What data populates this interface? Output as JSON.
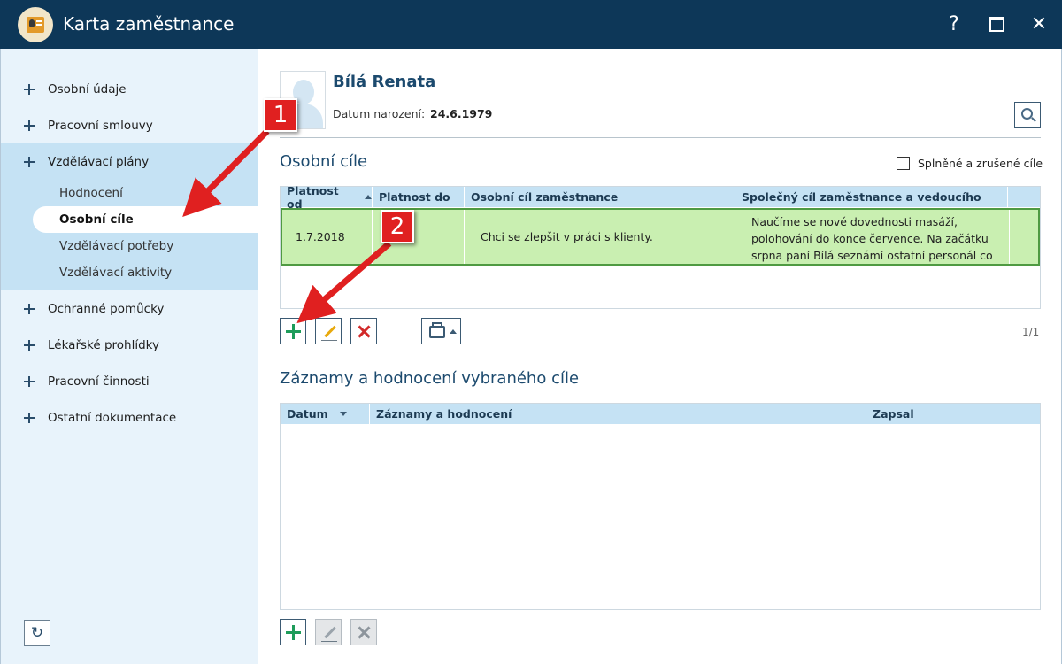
{
  "window": {
    "title": "Karta zaměstnance",
    "help_glyph": "?",
    "close_glyph": "✕"
  },
  "sidebar": {
    "items": [
      {
        "label": "Osobní údaje"
      },
      {
        "label": "Pracovní smlouvy"
      },
      {
        "label": "Vzdělávací plány"
      },
      {
        "label": "Ochranné pomůcky"
      },
      {
        "label": "Lékařské prohlídky"
      },
      {
        "label": "Pracovní činnosti"
      },
      {
        "label": "Ostatní dokumentace"
      }
    ],
    "sub_items": [
      {
        "label": "Hodnocení"
      },
      {
        "label": "Osobní cíle"
      },
      {
        "label": "Vzdělávací potřeby"
      },
      {
        "label": "Vzdělávací aktivity"
      }
    ],
    "refresh_glyph": "↻"
  },
  "employee": {
    "name": "Bílá Renata",
    "dob_label": "Datum narození:",
    "dob_value": "24.6.1979"
  },
  "goals": {
    "title": "Osobní cíle",
    "checkbox_label": "Splněné a zrušené cíle",
    "columns": [
      "Platnost od",
      "Platnost do",
      "Osobní cíl zaměstnance",
      "Společný cíl zaměstnance a vedoucího"
    ],
    "rows": [
      {
        "valid_from": "1.7.2018",
        "valid_to": "",
        "personal_goal": "Chci se zlepšit v práci s klienty.",
        "shared_goal": "Naučíme se nové dovednosti masáží, polohování do konce července. Na začátku srpna paní Bílá seznámí ostatní personál co se"
      }
    ],
    "pager": "1/1"
  },
  "records": {
    "title": "Záznamy a hodnocení vybraného cíle",
    "columns": [
      "Datum",
      "Záznamy a hodnocení",
      "Zapsal"
    ]
  },
  "annotations": [
    {
      "label": "1"
    },
    {
      "label": "2"
    }
  ],
  "colors": {
    "titlebar": "#0d3758",
    "sidebar_bg": "#e8f3fb",
    "sidebar_group": "#c5e2f4",
    "selected_row": "#c9efb1",
    "selected_row_border": "#4f9a42",
    "accent_title": "#1c4a6e",
    "annotation": "#e02020"
  }
}
